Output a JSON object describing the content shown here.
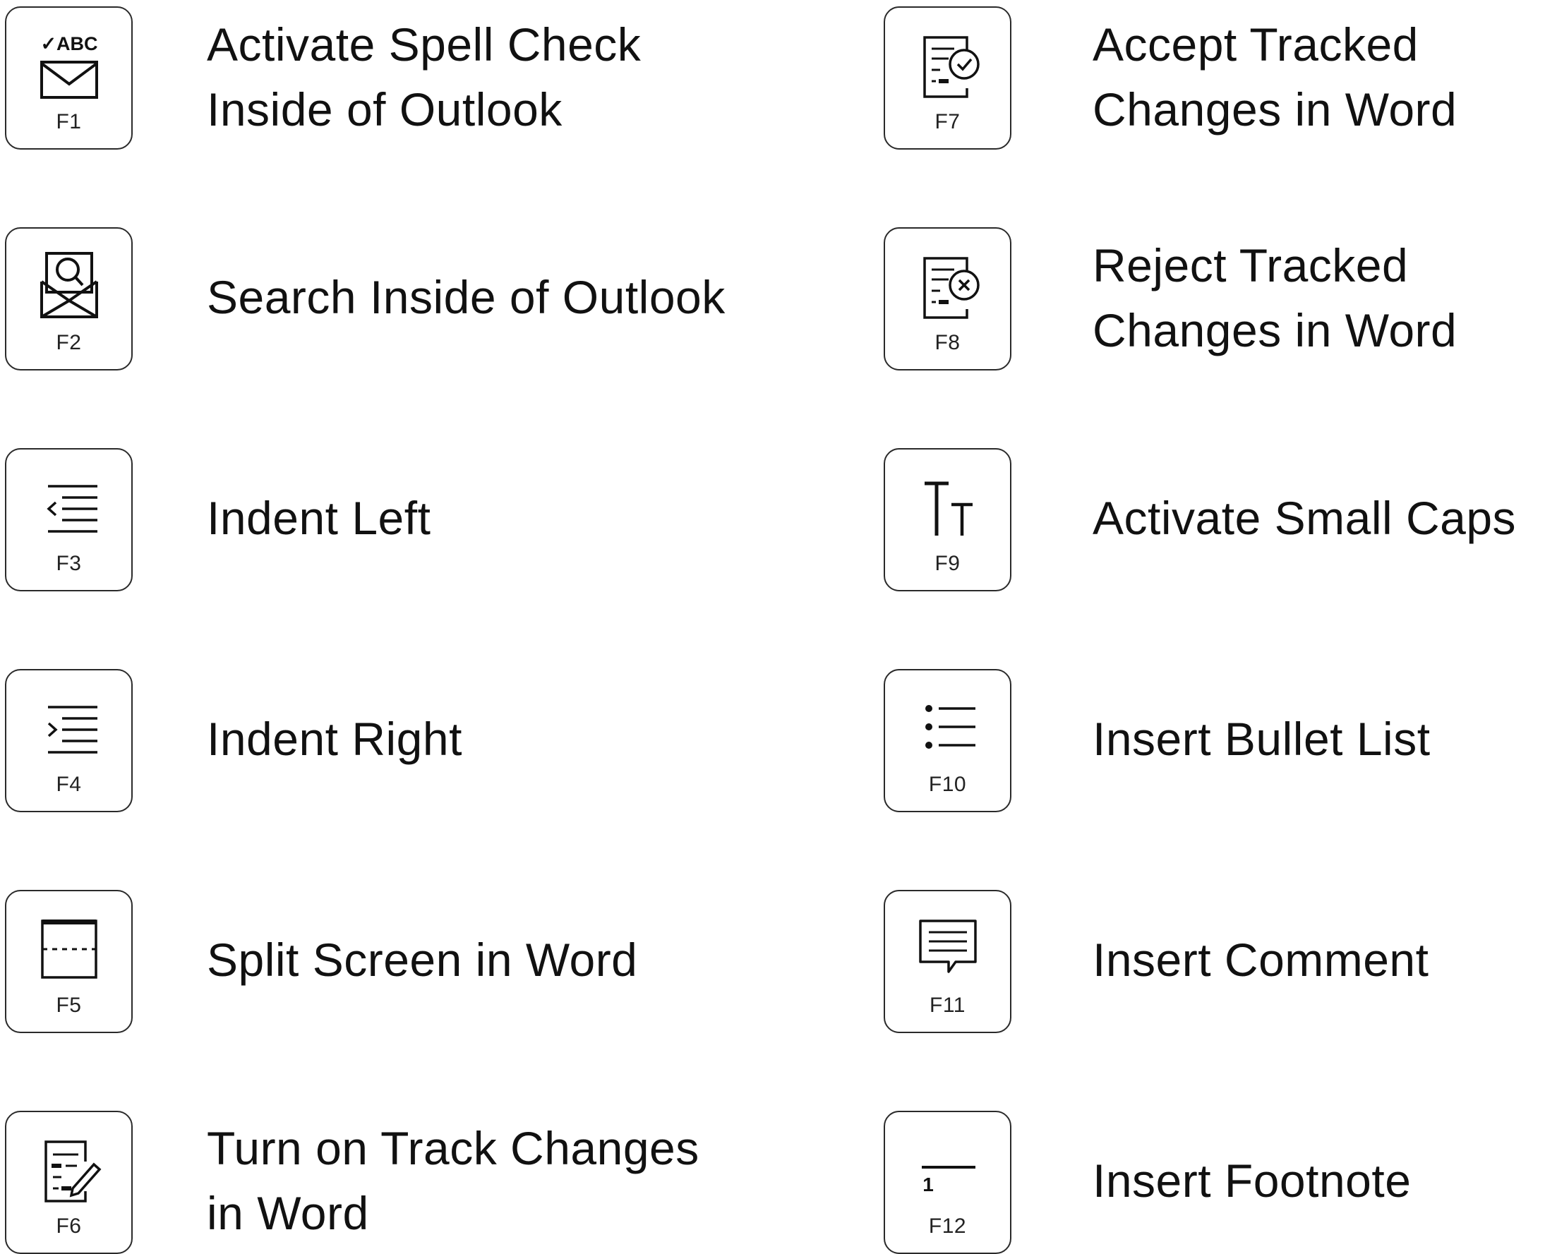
{
  "shortcuts": [
    {
      "key": "F1",
      "icon": "spell-check-mail-icon",
      "lines": [
        "Activate Spell Check",
        "Inside of Outlook"
      ],
      "mark": "✓ABC"
    },
    {
      "key": "F2",
      "icon": "search-mail-icon",
      "lines": [
        "Search Inside of Outlook"
      ]
    },
    {
      "key": "F3",
      "icon": "indent-left-icon",
      "lines": [
        "Indent Left"
      ]
    },
    {
      "key": "F4",
      "icon": "indent-right-icon",
      "lines": [
        "Indent Right"
      ]
    },
    {
      "key": "F5",
      "icon": "split-screen-icon",
      "lines": [
        "Split Screen in Word"
      ]
    },
    {
      "key": "F6",
      "icon": "track-changes-icon",
      "lines": [
        "Turn on Track Changes",
        "in Word"
      ]
    },
    {
      "key": "F7",
      "icon": "accept-changes-icon",
      "lines": [
        "Accept Tracked",
        "Changes in Word"
      ]
    },
    {
      "key": "F8",
      "icon": "reject-changes-icon",
      "lines": [
        "Reject Tracked",
        "Changes in Word"
      ]
    },
    {
      "key": "F9",
      "icon": "small-caps-icon",
      "lines": [
        "Activate Small Caps"
      ],
      "mark": "TT"
    },
    {
      "key": "F10",
      "icon": "bullet-list-icon",
      "lines": [
        "Insert Bullet List"
      ]
    },
    {
      "key": "F11",
      "icon": "comment-icon",
      "lines": [
        "Insert Comment"
      ]
    },
    {
      "key": "F12",
      "icon": "footnote-icon",
      "lines": [
        "Insert Footnote"
      ],
      "mark": "1"
    }
  ]
}
